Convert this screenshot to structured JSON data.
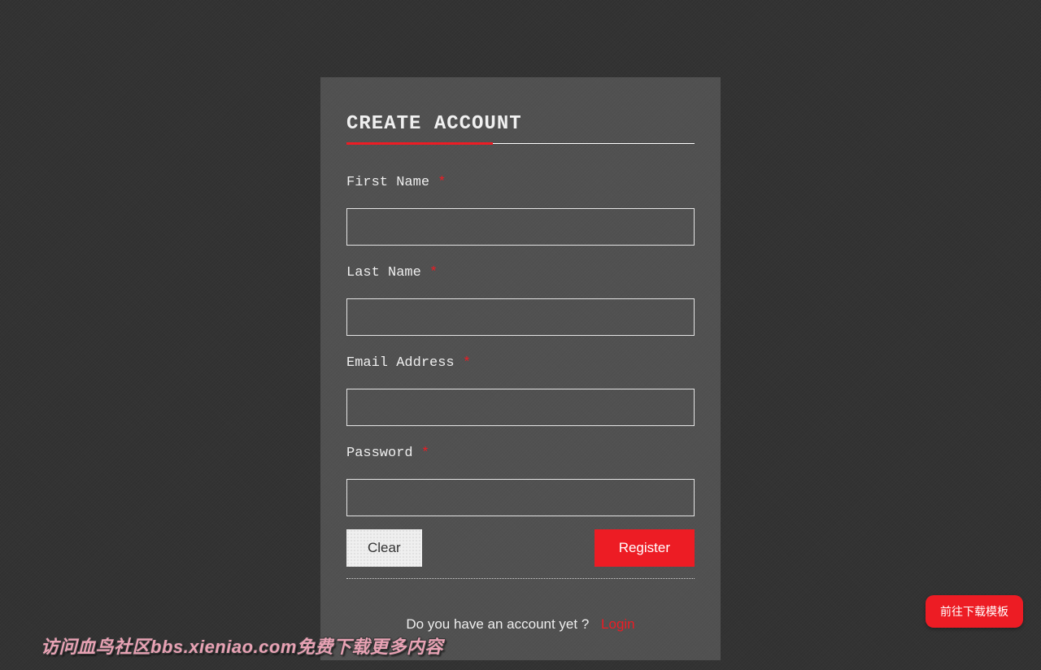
{
  "form": {
    "heading": "CREATE ACCOUNT",
    "required_mark": "*",
    "fields": {
      "first_name": {
        "label": "First Name",
        "value": ""
      },
      "last_name": {
        "label": "Last Name",
        "value": ""
      },
      "email": {
        "label": "Email Address",
        "value": ""
      },
      "password": {
        "label": "Password",
        "value": ""
      }
    },
    "buttons": {
      "clear": "Clear",
      "register": "Register"
    },
    "existing_account_prompt": "Do you have an account yet ?",
    "login_link_label": "Login"
  },
  "floating_button": {
    "label": "前往下载模板"
  },
  "watermark": {
    "text": "访问血鸟社区bbs.xieniao.com免费下载更多内容"
  },
  "colors": {
    "accent": "#ed1c24",
    "panel_overlay": "rgba(255,255,255,0.15)",
    "background": "#333333"
  }
}
